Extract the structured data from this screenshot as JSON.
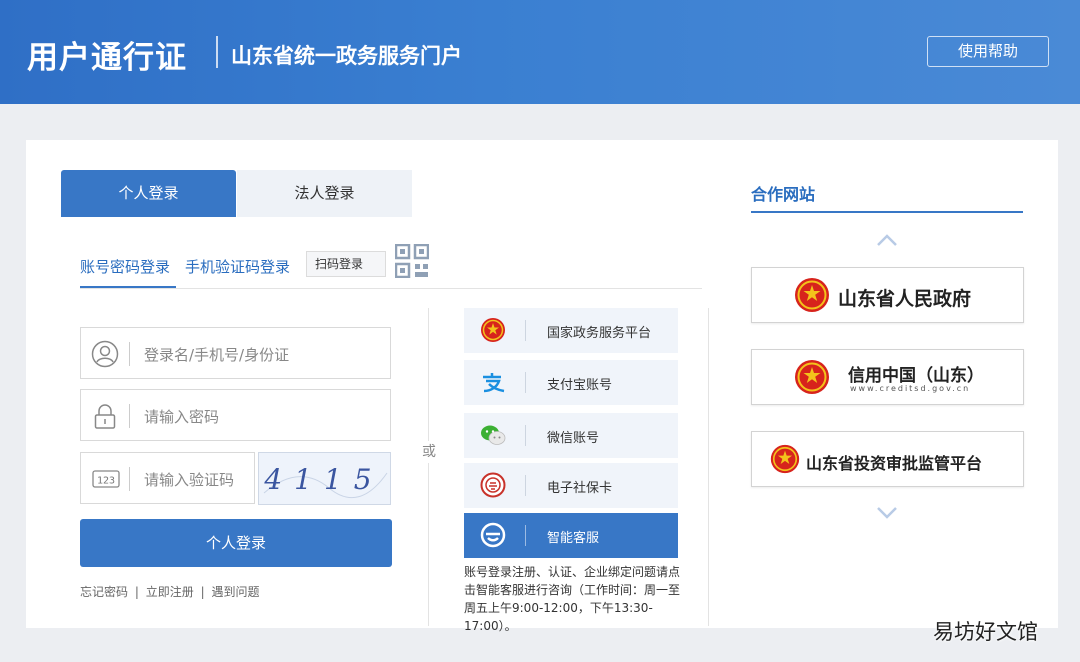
{
  "header": {
    "title": "用户通行证",
    "subtitle": "山东省统一政务服务门户",
    "help_label": "使用帮助"
  },
  "login": {
    "tabs": [
      {
        "label": "个人登录",
        "active": true
      },
      {
        "label": "法人登录",
        "active": false
      }
    ],
    "methods": {
      "password": "账号密码登录",
      "sms": "手机验证码登录",
      "scan": "扫码登录"
    },
    "fields": {
      "username_placeholder": "登录名/手机号/身份证",
      "password_placeholder": "请输入密码",
      "captcha_placeholder": "请输入验证码",
      "captcha_image_text": "4115",
      "captcha_icon_text": "123"
    },
    "submit_label": "个人登录",
    "links": [
      "忘记密码",
      "立即注册",
      "遇到问题"
    ],
    "link_separator": "|",
    "or_text": "或"
  },
  "alt_logins": [
    {
      "label": "国家政务服务平台",
      "icon": "national-emblem-icon"
    },
    {
      "label": "支付宝账号",
      "icon": "alipay-icon"
    },
    {
      "label": "微信账号",
      "icon": "wechat-icon"
    },
    {
      "label": "电子社保卡",
      "icon": "social-security-card-icon"
    },
    {
      "label": "智能客服",
      "icon": "smart-service-icon",
      "primary": true
    }
  ],
  "service_note": "账号登录注册、认证、企业绑定问题请点击智能客服进行咨询（工作时间：周一至周五上午9:00-12:00，下午13:30-17:00）。",
  "partners": {
    "title": "合作网站",
    "items": [
      {
        "name": "山东省人民政府",
        "url": ""
      },
      {
        "name": "信用中国（山东）",
        "url": "www.creditsd.gov.cn"
      },
      {
        "name": "山东省投资审批监管平台",
        "url": ""
      }
    ]
  },
  "watermark": "易坊好文馆",
  "colors": {
    "primary": "#3877c6",
    "header": "#3a7fd1",
    "link": "#2a6dbf",
    "emblem_red": "#d7231c",
    "emblem_gold": "#f3c21b"
  }
}
